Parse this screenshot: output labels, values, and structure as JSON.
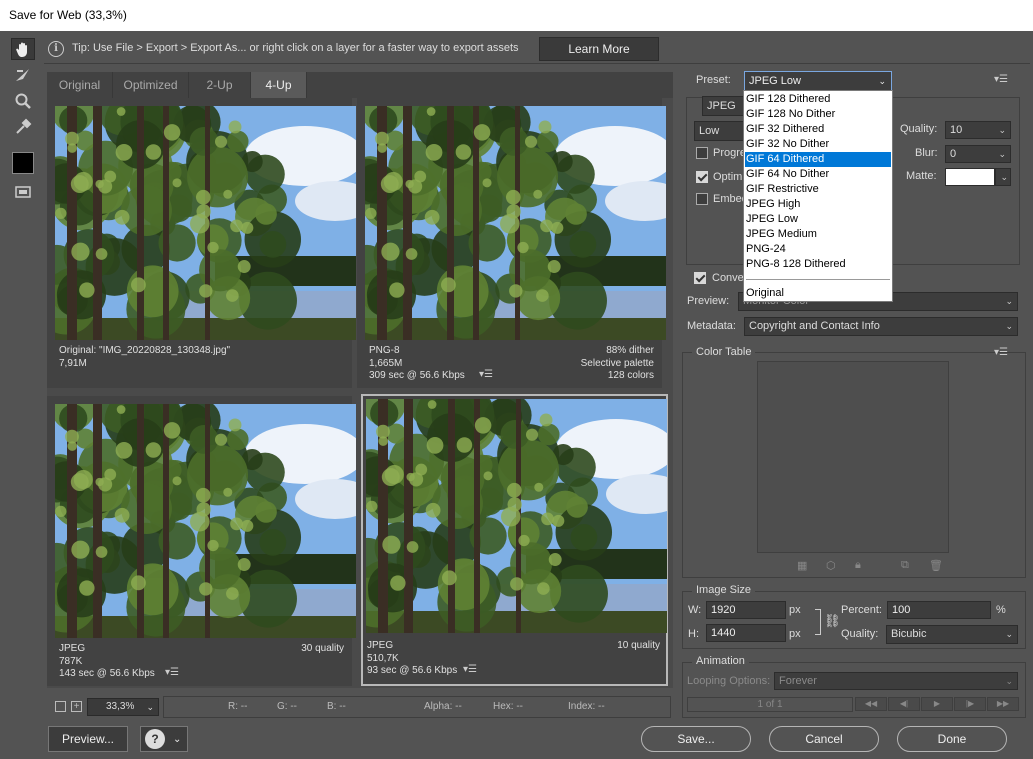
{
  "window": {
    "title": "Save for Web (33,3%)"
  },
  "tip": {
    "text": "Tip: Use File > Export > Export As... or right click on a layer for a faster way to export assets",
    "learn_more": "Learn More"
  },
  "tabs": [
    "Original",
    "Optimized",
    "2-Up",
    "4-Up"
  ],
  "active_tab": "4-Up",
  "panes": [
    {
      "left_lines": [
        "Original: \"IMG_20220828_130348.jpg\"",
        "7,91M"
      ],
      "right_lines": [],
      "has_menu": false
    },
    {
      "left_lines": [
        "PNG-8",
        "1,665M",
        "309 sec @ 56.6 Kbps"
      ],
      "right_lines": [
        "88% dither",
        "Selective palette",
        "128 colors"
      ],
      "has_menu": true
    },
    {
      "left_lines": [
        "JPEG",
        "787K",
        "143 sec @ 56.6 Kbps"
      ],
      "right_lines": [
        "30 quality"
      ],
      "has_menu": true
    },
    {
      "left_lines": [
        "JPEG",
        "510,7K",
        "93 sec @ 56.6 Kbps"
      ],
      "right_lines": [
        "10 quality"
      ],
      "has_menu": true
    }
  ],
  "status": {
    "zoom": "33,3%",
    "r": "R: --",
    "g": "G: --",
    "b": "B: --",
    "alpha": "Alpha: --",
    "hex": "Hex: --",
    "index": "Index: --"
  },
  "buttons": {
    "preview": "Preview...",
    "save": "Save...",
    "cancel": "Cancel",
    "done": "Done"
  },
  "settings": {
    "preset_label": "Preset:",
    "preset_value": "JPEG Low",
    "format": "JPEG",
    "quality_level": "Low",
    "quality_label": "Quality:",
    "quality_value": "10",
    "blur_label": "Blur:",
    "blur_value": "0",
    "matte_label": "Matte:",
    "progressive": "Progre",
    "optimized": "Optim",
    "embed": "Embed",
    "convert": "Conve",
    "preview_label": "Preview:",
    "preview_value": "Monitor Color",
    "metadata_label": "Metadata:",
    "metadata_value": "Copyright and Contact Info"
  },
  "preset_options": [
    "GIF 128 Dithered",
    "GIF 128 No Dither",
    "GIF 32 Dithered",
    "GIF 32 No Dither",
    "GIF 64 Dithered",
    "GIF 64 No Dither",
    "GIF Restrictive",
    "JPEG High",
    "JPEG Low",
    "JPEG Medium",
    "PNG-24",
    "PNG-8 128 Dithered",
    "Original"
  ],
  "preset_highlighted": "GIF 64 Dithered",
  "color_table": {
    "title": "Color Table"
  },
  "image_size": {
    "title": "Image Size",
    "w_label": "W:",
    "w_value": "1920",
    "h_label": "H:",
    "h_value": "1440",
    "px": "px",
    "percent_label": "Percent:",
    "percent_value": "100",
    "percent_unit": "%",
    "quality_label": "Quality:",
    "quality_value": "Bicubic"
  },
  "animation": {
    "title": "Animation",
    "looping_label": "Looping Options:",
    "looping_value": "Forever",
    "frame_counter": "1 of 1"
  },
  "colors": {
    "bg": "#535353",
    "highlight": "#0078d7"
  }
}
